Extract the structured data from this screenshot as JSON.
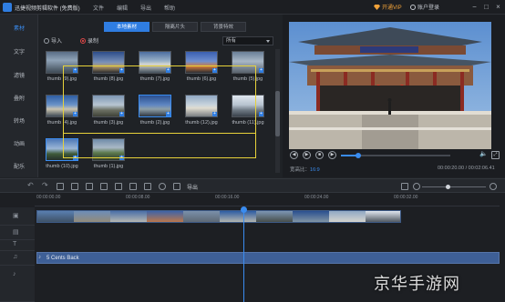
{
  "app": {
    "title": "迅捷视频剪辑软件 (免费版)",
    "menu": [
      "文件",
      "编辑",
      "导出",
      "帮助"
    ],
    "vip_label": "开通VIP",
    "login_label": "账户登录",
    "window_controls": [
      "minimize-icon",
      "maximize-icon",
      "close-icon"
    ]
  },
  "sidebar": {
    "items": [
      {
        "label": "素材",
        "active": true
      },
      {
        "label": "文字",
        "active": false
      },
      {
        "label": "滤镜",
        "active": false
      },
      {
        "label": "叠附",
        "active": false
      },
      {
        "label": "转场",
        "active": false
      },
      {
        "label": "动画",
        "active": false
      },
      {
        "label": "配乐",
        "active": false
      }
    ]
  },
  "media": {
    "tabs": [
      {
        "label": "本地素材",
        "active": true
      },
      {
        "label": "隔离片头",
        "active": false
      },
      {
        "label": "背景特效",
        "active": false
      }
    ],
    "import_label": "导入",
    "record_label": "录制",
    "filter_value": "所有",
    "thumbnails": [
      {
        "label": "thumb (9).jpg"
      },
      {
        "label": "thumb (8).jpg"
      },
      {
        "label": "thumb (7).jpg"
      },
      {
        "label": "thumb (6).jpg"
      },
      {
        "label": "thumb (5).jpg"
      },
      {
        "label": "thumb (4).jpg"
      },
      {
        "label": "thumb (3).jpg"
      },
      {
        "label": "thumb (2).jpg"
      },
      {
        "label": "thumb (12).jpg"
      },
      {
        "label": "thumb (11).jpg"
      },
      {
        "label": "thumb (10).jpg"
      },
      {
        "label": "thumb (1).jpg"
      }
    ]
  },
  "preview": {
    "ratio_label": "宽高比：",
    "ratio_value": "16:9",
    "time": "00:00:20.00 / 00:02:06.41",
    "progress": 0.16,
    "controls": [
      "prev-icon",
      "play-icon",
      "stop-icon",
      "next-icon",
      "volume-icon",
      "fullscreen-icon"
    ]
  },
  "toolbar": {
    "export_label": "导出",
    "tools": [
      "undo-icon",
      "redo-icon",
      "edit-icon",
      "split-icon",
      "delete-icon",
      "crop-icon",
      "mosaic-icon",
      "speed-icon",
      "freeze-icon",
      "voice-icon",
      "record-icon"
    ],
    "zoom_level": 0.4
  },
  "timeline": {
    "ticks": [
      "00:00:00.00",
      "00:00:08.00",
      "00:00:16.00",
      "00:00:24.00",
      "00:00:32.00"
    ],
    "audio_clip": "5 Cents Back"
  },
  "watermark": "京华手游网"
}
